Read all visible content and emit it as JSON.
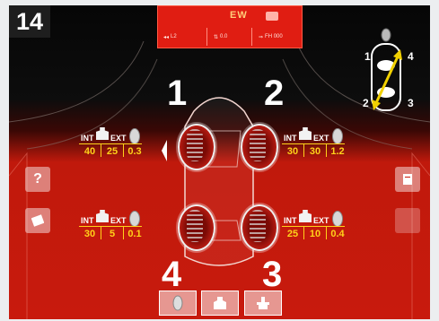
{
  "step_number": "14",
  "top_bar": {
    "mode_text": "EW",
    "left_readout": "L2",
    "middle_readout": "0.0",
    "right_readout": "FH 000"
  },
  "positions": {
    "p1": "1",
    "p2": "2",
    "p3": "3",
    "p4": "4"
  },
  "mini_diagram": {
    "l1": "1",
    "l2": "2",
    "l3": "3",
    "l4": "4"
  },
  "wheels": {
    "front_left": {
      "int_label": "INT",
      "ext_label": "EXT",
      "int": "40",
      "ext": "25",
      "residual": "0.3"
    },
    "front_right": {
      "int_label": "INT",
      "ext_label": "EXT",
      "int": "30",
      "ext": "30",
      "residual": "1.2"
    },
    "rear_left": {
      "int_label": "INT",
      "ext_label": "EXT",
      "int": "30",
      "ext": "5",
      "residual": "0.1"
    },
    "rear_right": {
      "int_label": "INT",
      "ext_label": "EXT",
      "int": "25",
      "ext": "10",
      "residual": "0.4"
    }
  },
  "side_buttons": {
    "help": "?",
    "left_icon": "info-icon",
    "right_icon": "file-icon",
    "right_lower_icon": "blank"
  },
  "bottom_buttons": [
    {
      "icon": "wheel-icon"
    },
    {
      "icon": "weight-icon"
    },
    {
      "icon": "balancer-icon"
    }
  ],
  "colors": {
    "accent_red": "#c81a0d",
    "value_yellow": "#ffd21a",
    "arrow": "#f0d000"
  }
}
